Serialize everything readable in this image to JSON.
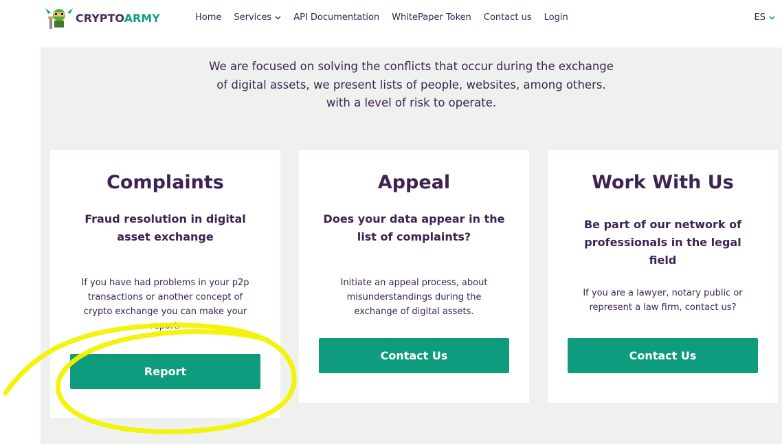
{
  "header": {
    "logo": {
      "part1": "CRYPTO",
      "part2": "ARMY"
    },
    "nav": [
      {
        "label": "Home"
      },
      {
        "label": "Services",
        "dropdown": true
      },
      {
        "label": "API Documentation"
      },
      {
        "label": "WhitePaper Token"
      },
      {
        "label": "Contact us"
      },
      {
        "label": "Login"
      }
    ],
    "language": "ES"
  },
  "intro": {
    "line1": "We are focused on solving the conflicts that occur during the exchange",
    "line2": "of digital assets, we present lists of people, websites, among others.",
    "line3": "with a level of risk to operate."
  },
  "cards": [
    {
      "title": "Complaints",
      "subtitle_lines": [
        "Fraud resolution in digital",
        "asset exchange"
      ],
      "description_lines": [
        "If you have had problems in your p2p",
        "transactions or another concept of",
        "crypto exchange you can make your",
        "report."
      ],
      "button": "Report"
    },
    {
      "title": "Appeal",
      "subtitle_lines": [
        "Does your data appear in the",
        "list of complaints?"
      ],
      "description_lines": [
        "Initiate an appeal process, about",
        "misunderstandings during the",
        "exchange of digital assets."
      ],
      "button": "Contact Us"
    },
    {
      "title": "Work With Us",
      "subtitle_lines": [
        "Be part of our network of",
        "professionals in the legal",
        "field"
      ],
      "description_lines": [
        "If you are a lawyer, notary public or",
        "represent a law firm, contact us?"
      ],
      "button": "Contact Us"
    }
  ],
  "colors": {
    "accent": "#0f9b7e",
    "text": "#3d2252",
    "section_bg": "#eff1ef",
    "highlight": "#f2f200"
  }
}
